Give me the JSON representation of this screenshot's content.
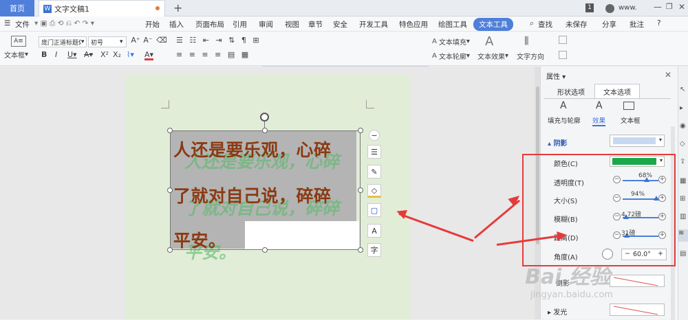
{
  "tabs": {
    "home": "首页",
    "doc": "文字文稿1",
    "new": "+"
  },
  "topright": {
    "badge": "1",
    "user": "www."
  },
  "menu": {
    "file": "文件",
    "items": [
      "开始",
      "插入",
      "页面布局",
      "引用",
      "审阅",
      "视图",
      "章节",
      "安全",
      "开发工具",
      "特色应用",
      "绘图工具",
      "文本工具"
    ],
    "right": [
      "查找",
      "未保存",
      "分享",
      "批注",
      "?"
    ]
  },
  "ribbon": {
    "textbox": "文本框",
    "font_name": "庞门正道标题体",
    "font_size": "初号",
    "text_fill": "文本填充",
    "text_outline": "文本轮廓",
    "text_effect": "文本效果",
    "text_direction": "文字方向",
    "wordart_letter": "A",
    "wordart_colors": [
      "#111111",
      "#3b8ad9",
      "#e8743b",
      "#3b8ad9",
      "#f0c000",
      "#888888"
    ]
  },
  "document": {
    "line1": "人还是要乐观，心碎",
    "line2": "了就对自己说，碎碎",
    "line3": "平安。",
    "text_color": "#8a3a12",
    "shadow_color": "#5ab86a"
  },
  "float_buttons": [
    "−",
    "☰",
    "✎",
    "◇",
    "▢",
    "A",
    "字"
  ],
  "panel": {
    "title": "属性",
    "tab_shape": "形状选项",
    "tab_text": "文本选项",
    "sub_fill": "填充与轮廓",
    "sub_effect": "效果",
    "sub_textbox": "文本框",
    "shadow": "阴影",
    "color_label": "颜色(C)",
    "color_value": "#1aa84a",
    "transparency_label": "透明度(T)",
    "transparency_value": "68%",
    "transparency_fraction": 0.68,
    "size_label": "大小(S)",
    "size_value": "94%",
    "size_fraction": 0.94,
    "blur_label": "模糊(B)",
    "blur_value": "4.72磅",
    "blur_fraction": 0.1,
    "distance_label": "距离(D)",
    "distance_value": "31磅",
    "distance_fraction": 0.12,
    "angle_label": "角度(A)",
    "angle_value": "60.0°",
    "reflection": "倒影",
    "glow": "发光"
  },
  "watermark": {
    "brand": "Bai 经验",
    "url": "jingyan.baidu.com"
  }
}
